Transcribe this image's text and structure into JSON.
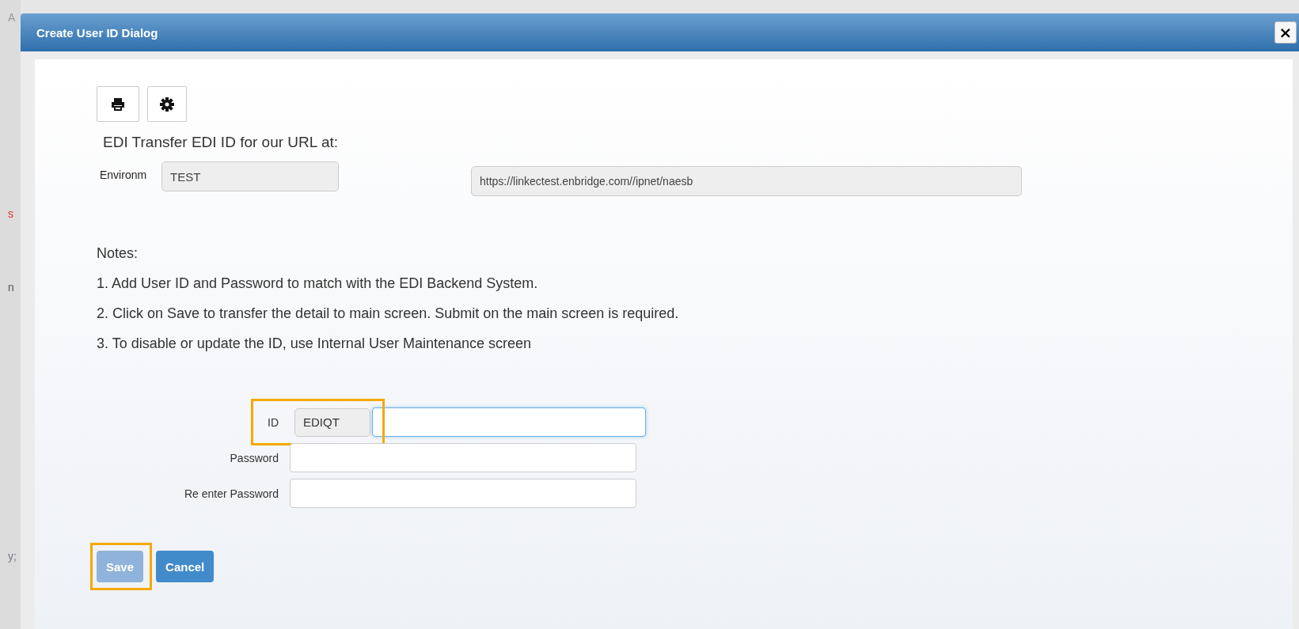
{
  "background_fragments": [
    "A",
    "s",
    "n",
    "y;"
  ],
  "dialog": {
    "title": "Create User ID Dialog",
    "close": "×"
  },
  "toolbar": [
    {
      "kind": "print"
    },
    {
      "kind": "settings"
    }
  ],
  "heading": "EDI Transfer EDI ID for our URL at:",
  "environment": {
    "label": "Environm",
    "value": "TEST",
    "disabled": true
  },
  "url": {
    "value": "https://linkectest.enbridge.com//ipnet/naesb",
    "disabled": true
  },
  "notes": {
    "title": "Notes:",
    "items": [
      "1. Add User ID and Password to match with the EDI Backend System.",
      "2. Click on Save to transfer the detail to main screen. Submit on the main screen is required.",
      "3. To disable or update the ID, use Internal User Maintenance screen"
    ]
  },
  "form": [
    {
      "kind": "prefixed",
      "label": "ID",
      "prefix": "EDIQT",
      "focused": true,
      "highlighted": true
    },
    {
      "kind": "plain",
      "label": "Password",
      "focused": false,
      "highlighted": false
    },
    {
      "kind": "plain",
      "label": "Re enter Password",
      "focused": false,
      "highlighted": false
    }
  ],
  "buttons": [
    {
      "label": "Save",
      "disabled": true,
      "highlighted": true
    },
    {
      "label": "Cancel",
      "disabled": false,
      "highlighted": false
    }
  ]
}
